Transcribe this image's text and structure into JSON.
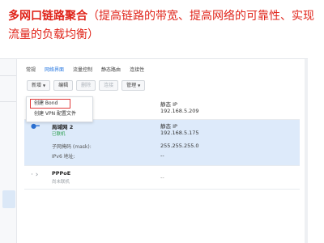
{
  "headline": {
    "lead": "多网口链路聚合",
    "rest": "（提高链路的带宽、提高网络的可靠性、实现流量的负载均衡）"
  },
  "tabs": [
    {
      "label": "常规",
      "active": false
    },
    {
      "label": "网络界面",
      "active": true
    },
    {
      "label": "流量控制",
      "active": false
    },
    {
      "label": "静态路由",
      "active": false
    },
    {
      "label": "连接性",
      "active": false
    }
  ],
  "toolbar": {
    "add": "新增",
    "edit": "编辑",
    "delete": "删除",
    "connect": "连接",
    "manage": "管理"
  },
  "dropdown": {
    "create_bond": "创建 Bond",
    "create_vpn": "创建 VPN 配置文件"
  },
  "networks": [
    {
      "name": "",
      "status": "",
      "ip_type": "静态 IP",
      "ip": "192.168.5.209"
    },
    {
      "name": "局域网 2",
      "status": "已联机",
      "ip_type": "静态 IP",
      "ip": "192.168.5.175",
      "mask_label": "子网掩码 (mask):",
      "mask": "255.255.255.0",
      "ipv6_label": "IPv6 地址:",
      "ipv6": "--"
    },
    {
      "name": "PPPoE",
      "status": "尚未联机",
      "value": "--"
    }
  ],
  "colors": {
    "accent": "#2a7ae2",
    "headline": "#e0241a",
    "highlight_box": "#e03a3a",
    "selected_row": "#ddeafa",
    "connected": "#2a9d4c"
  }
}
